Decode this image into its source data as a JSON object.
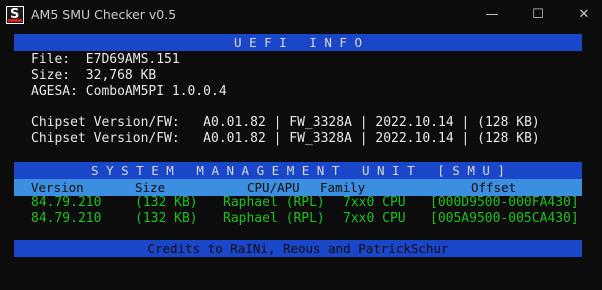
{
  "window": {
    "title": "AM5 SMU Checker v0.5",
    "icon_letter": "S",
    "min_glyph": "—",
    "max_glyph": "☐",
    "close_glyph": "✕"
  },
  "uefi": {
    "header": "U E F I   I N F O",
    "file": "File:  E7D69AMS.151",
    "size": "Size:  32,768 KB",
    "agesa": "AGESA: ComboAM5PI 1.0.0.4",
    "chipset_rows": [
      "Chipset Version/FW:   A0.01.82 | FW_3328A | 2022.10.14 | (128 KB)",
      "Chipset Version/FW:   A0.01.82 | FW_3328A | 2022.10.14 | (128 KB)"
    ]
  },
  "smu": {
    "header": "S Y S T E M   M A N A G E M E N T   U N I T   [ S M U ]",
    "columns": [
      "Version",
      "Size",
      "CPU/APU",
      "Family",
      "Offset"
    ],
    "rows": [
      [
        "84.79.210",
        "(132 KB)",
        "Raphael (RPL)",
        "7xx0 CPU",
        "[000D9500-000FA430]"
      ],
      [
        "84.79.210",
        "(132 KB)",
        "Raphael (RPL)",
        "7xx0 CPU",
        "[005A9500-005CA430]"
      ]
    ]
  },
  "credits": "Credits to RaINi, Reous and PatrickSchur",
  "colors": {
    "background": "#0c0c0c",
    "band_blue": "#1a47c9",
    "column_header_blue": "#3b8ee0",
    "text_green": "#19c31a",
    "text_white": "#e8e8e8"
  }
}
